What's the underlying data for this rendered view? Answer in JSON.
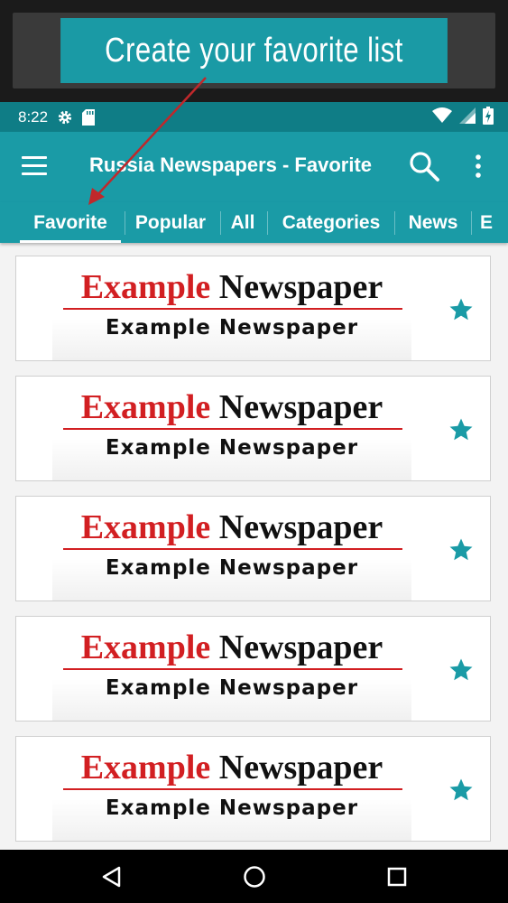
{
  "promo": {
    "text": "Create your favorite list"
  },
  "status_bar": {
    "time": "8:22",
    "left_icons": [
      "gear-icon",
      "sd-card-icon"
    ],
    "right_icons": [
      "wifi-icon",
      "cell-signal-icon",
      "battery-charging-icon"
    ]
  },
  "toolbar": {
    "title": "Russia Newspapers - Favorite",
    "menu_icon": "hamburger-menu-icon",
    "search_icon": "search-icon",
    "more_icon": "more-vert-icon"
  },
  "tabs": [
    {
      "label": "Favorite",
      "selected": true
    },
    {
      "label": "Popular",
      "selected": false
    },
    {
      "label": "All",
      "selected": false
    },
    {
      "label": "Categories",
      "selected": false
    },
    {
      "label": "News",
      "selected": false
    },
    {
      "label": "E",
      "selected": false
    }
  ],
  "cards": [
    {
      "logo_red": "Example",
      "logo_black": "Newspaper",
      "subtitle": "Example Newspaper",
      "favorite": true
    },
    {
      "logo_red": "Example",
      "logo_black": "Newspaper",
      "subtitle": "Example Newspaper",
      "favorite": true
    },
    {
      "logo_red": "Example",
      "logo_black": "Newspaper",
      "subtitle": "Example Newspaper",
      "favorite": true
    },
    {
      "logo_red": "Example",
      "logo_black": "Newspaper",
      "subtitle": "Example Newspaper",
      "favorite": true
    },
    {
      "logo_red": "Example",
      "logo_black": "Newspaper",
      "subtitle": "Example Newspaper",
      "favorite": true
    }
  ],
  "nav_bar": {
    "icons": [
      "back-icon",
      "home-icon",
      "recents-icon"
    ]
  },
  "colors": {
    "primary": "#1a9ba6",
    "primary_dark": "#0f7d86",
    "accent_star": "#1a9ba6",
    "logo_red": "#d21f22",
    "arrow": "#c0282b"
  }
}
